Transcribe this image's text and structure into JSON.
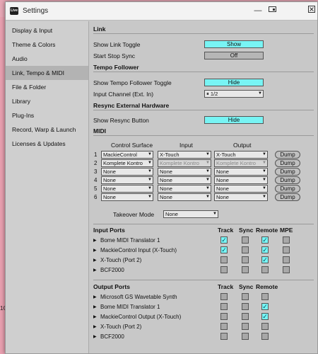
{
  "window": {
    "title": "Settings",
    "app_icon": "Live"
  },
  "titlebar": {
    "icons": [
      "minimize-icon",
      "screen-icon",
      "close-icon"
    ]
  },
  "sidebar": {
    "items": [
      {
        "label": "Display & Input",
        "active": false
      },
      {
        "label": "Theme & Colors",
        "active": false
      },
      {
        "label": "Audio",
        "active": false
      },
      {
        "label": "Link, Tempo & MIDI",
        "active": true
      },
      {
        "label": "File & Folder",
        "active": false
      },
      {
        "label": "Library",
        "active": false
      },
      {
        "label": "Plug-Ins",
        "active": false
      },
      {
        "label": "Record, Warp & Launch",
        "active": false
      },
      {
        "label": "Licenses & Updates",
        "active": false
      }
    ]
  },
  "link": {
    "heading": "Link",
    "show_link_toggle_label": "Show Link Toggle",
    "show_link_toggle_value": "Show",
    "start_stop_sync_label": "Start Stop Sync",
    "start_stop_sync_value": "Off"
  },
  "tempo": {
    "heading": "Tempo Follower",
    "show_toggle_label": "Show Tempo Follower Toggle",
    "show_toggle_value": "Hide",
    "input_channel_label": "Input Channel (Ext. In)",
    "input_channel_value": "1/2"
  },
  "resync": {
    "heading": "Resync External Hardware",
    "show_button_label": "Show Resync Button",
    "show_button_value": "Hide"
  },
  "midi": {
    "heading": "MIDI",
    "col_surface": "Control Surface",
    "col_input": "Input",
    "col_output": "Output",
    "dump_label": "Dump",
    "rows": [
      {
        "num": "1",
        "surface": "MackieControl",
        "input": "X-Touch",
        "output": "X-Touch",
        "dim": false
      },
      {
        "num": "2",
        "surface": "Komplete Kontro",
        "input": "Komplete Kontro",
        "output": "Komplete Kontro",
        "dim": true
      },
      {
        "num": "3",
        "surface": "None",
        "input": "None",
        "output": "None",
        "dim": false
      },
      {
        "num": "4",
        "surface": "None",
        "input": "None",
        "output": "None",
        "dim": false
      },
      {
        "num": "5",
        "surface": "None",
        "input": "None",
        "output": "None",
        "dim": false
      },
      {
        "num": "6",
        "surface": "None",
        "input": "None",
        "output": "None",
        "dim": false
      }
    ],
    "takeover_label": "Takeover Mode",
    "takeover_value": "None"
  },
  "input_ports": {
    "heading": "Input Ports",
    "cols": [
      "Track",
      "Sync",
      "Remote",
      "MPE"
    ],
    "rows": [
      {
        "name": "Bome MIDI Translator 1",
        "track": true,
        "sync": false,
        "remote": true,
        "mpe": false
      },
      {
        "name": "MackieControl Input (X-Touch)",
        "track": true,
        "sync": false,
        "remote": true,
        "mpe": false
      },
      {
        "name": "X-Touch (Port 2)",
        "track": false,
        "sync": false,
        "remote": true,
        "mpe": false
      },
      {
        "name": "BCF2000",
        "track": false,
        "sync": false,
        "remote": false,
        "mpe": false
      }
    ]
  },
  "output_ports": {
    "heading": "Output Ports",
    "cols": [
      "Track",
      "Sync",
      "Remote"
    ],
    "rows": [
      {
        "name": "Microsoft GS Wavetable Synth",
        "track": false,
        "sync": false,
        "remote": false
      },
      {
        "name": "Bome MIDI Translator 1",
        "track": false,
        "sync": false,
        "remote": true
      },
      {
        "name": "MackieControl Output (X-Touch)",
        "track": false,
        "sync": false,
        "remote": true
      },
      {
        "name": "X-Touch (Port 2)",
        "track": false,
        "sync": false,
        "remote": false
      },
      {
        "name": "BCF2000",
        "track": false,
        "sync": false,
        "remote": false
      }
    ]
  },
  "background": {
    "left_text": "1C"
  },
  "colors": {
    "toggle_on": "#78f4f4",
    "panel_bg": "#c8c8c8",
    "sidebar_active": "#b3b3b3"
  }
}
